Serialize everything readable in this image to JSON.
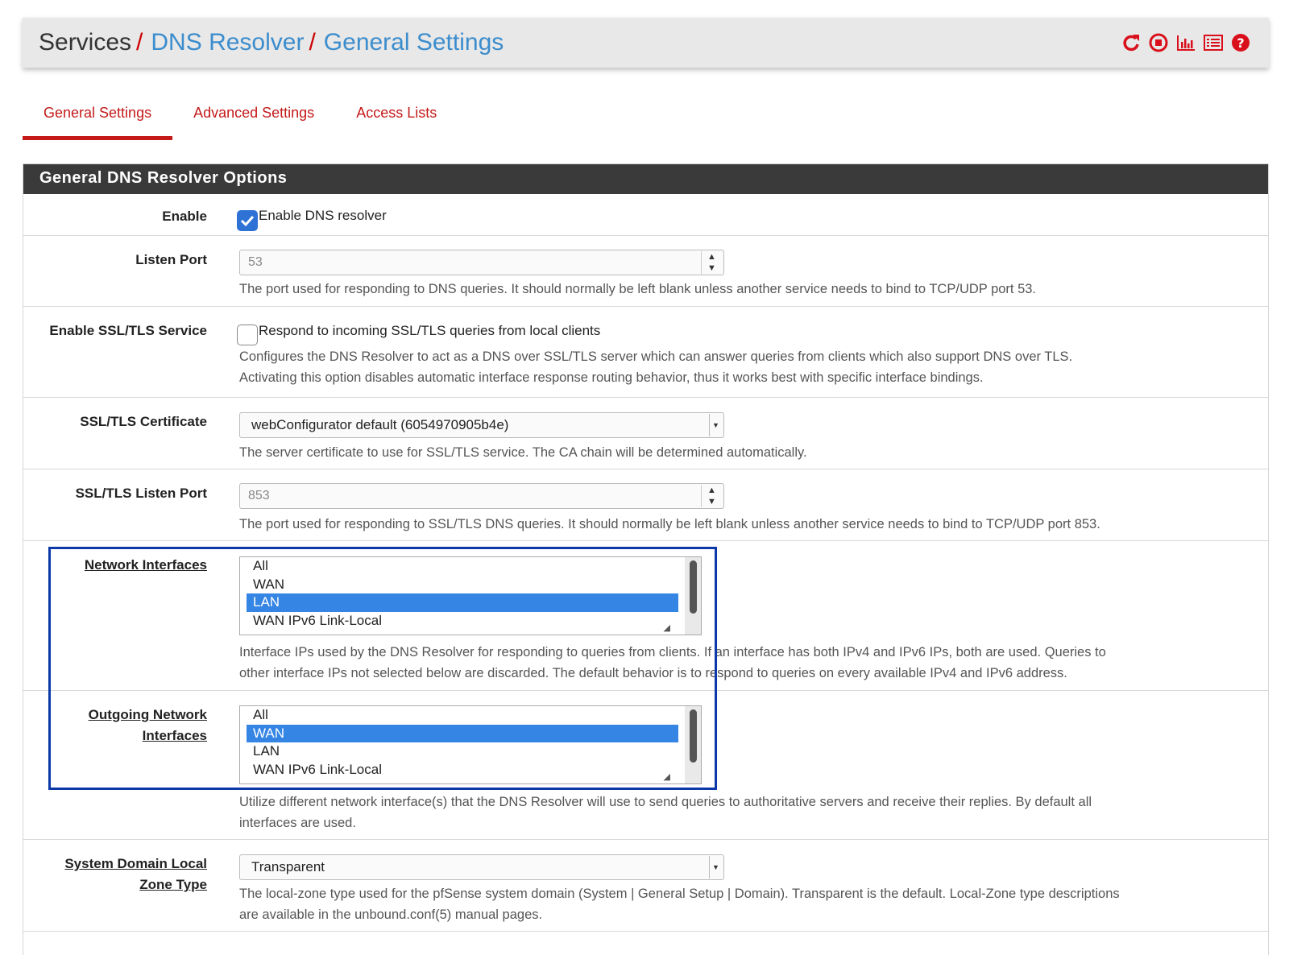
{
  "breadcrumb": [
    {
      "label": "Services",
      "sep": "/"
    },
    {
      "label": "DNS Resolver",
      "sep": "/"
    },
    {
      "label": "General Settings",
      "sep": ""
    }
  ],
  "header_icons": [
    "reload-icon",
    "stop-circle-icon",
    "bar-chart-icon",
    "list-icon",
    "help-icon"
  ],
  "colors": {
    "accent_red": "#c41a1a",
    "link_blue": "#3c8dcd",
    "selected_blue": "#3585e5",
    "panel_header": "#3a3a3a",
    "highlight_box": "#0b3aa8"
  },
  "tabs": [
    {
      "label": "General Settings",
      "active": true
    },
    {
      "label": "Advanced Settings",
      "active": false
    },
    {
      "label": "Access Lists",
      "active": false
    }
  ],
  "panel": {
    "title": "General DNS Resolver Options",
    "enable": {
      "label": "Enable",
      "checkbox_text": "Enable DNS resolver",
      "checked": true
    },
    "listen_port": {
      "label": "Listen Port",
      "placeholder": "53",
      "help": "The port used for responding to DNS queries. It should normally be left blank unless another service needs to bind to TCP/UDP port 53."
    },
    "ssl_service": {
      "label": "Enable SSL/TLS Service",
      "checkbox_text": "Respond to incoming SSL/TLS queries from local clients",
      "checked": false,
      "help_line1": "Configures the DNS Resolver to act as a DNS over SSL/TLS server which can answer queries from clients which also support DNS over TLS.",
      "help_line2": "Activating this option disables automatic interface response routing behavior, thus it works best with specific interface bindings."
    },
    "ssl_cert": {
      "label": "SSL/TLS Certificate",
      "value": "webConfigurator default (6054970905b4e)",
      "help": "The server certificate to use for SSL/TLS service. The CA chain will be determined automatically."
    },
    "ssl_port": {
      "label": "SSL/TLS Listen Port",
      "placeholder": "853",
      "help": "The port used for responding to SSL/TLS DNS queries. It should normally be left blank unless another service needs to bind to TCP/UDP port 853."
    },
    "network_interfaces": {
      "label": "Network Interfaces",
      "options": [
        "All",
        "WAN",
        "LAN",
        "WAN IPv6 Link-Local"
      ],
      "selected": "LAN",
      "help_line1": "Interface IPs used by the DNS Resolver for responding to queries from clients. If an interface has both IPv4 and IPv6 IPs, both are used. Queries to",
      "help_line2": "other interface IPs not selected below are discarded. The default behavior is to respond to queries on every available IPv4 and IPv6 address."
    },
    "outgoing_interfaces": {
      "label_line1": "Outgoing Network",
      "label_line2": "Interfaces",
      "options": [
        "All",
        "WAN",
        "LAN",
        "WAN IPv6 Link-Local"
      ],
      "selected": "WAN",
      "help_line1": "Utilize different network interface(s) that the DNS Resolver will use to send queries to authoritative servers and receive their replies. By default all",
      "help_line2": "interfaces are used."
    },
    "zone_type": {
      "label_line1": "System Domain Local",
      "label_line2": "Zone Type",
      "value": "Transparent",
      "help_line1": "The local-zone type used for the pfSense system domain (System | General Setup | Domain). Transparent is the default. Local-Zone type descriptions",
      "help_line2": "are available in the unbound.conf(5) manual pages."
    }
  }
}
